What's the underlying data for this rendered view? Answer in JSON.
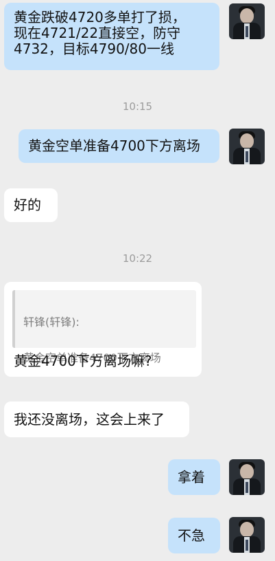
{
  "messages": {
    "m1": "黄金跌破4720多单打了损，\n现在4721/22直接空，防守\n4732，目标4790/80一线",
    "time1": "10:15",
    "m2": "黄金空单准备4700下方离场",
    "m3": "好的",
    "time2": "10:22",
    "m4": {
      "quote_author": "轩锋(轩锋):",
      "quote_text": "黄金空单准备4700下方离场",
      "reply": "黄金4700下方离场嘛?"
    },
    "m5": "我还没离场，这会上来了",
    "m6": "拿着",
    "m7": "不急"
  },
  "colors": {
    "outgoing": "#c5e2fb",
    "incoming": "#ffffff",
    "background": "#ededed"
  }
}
